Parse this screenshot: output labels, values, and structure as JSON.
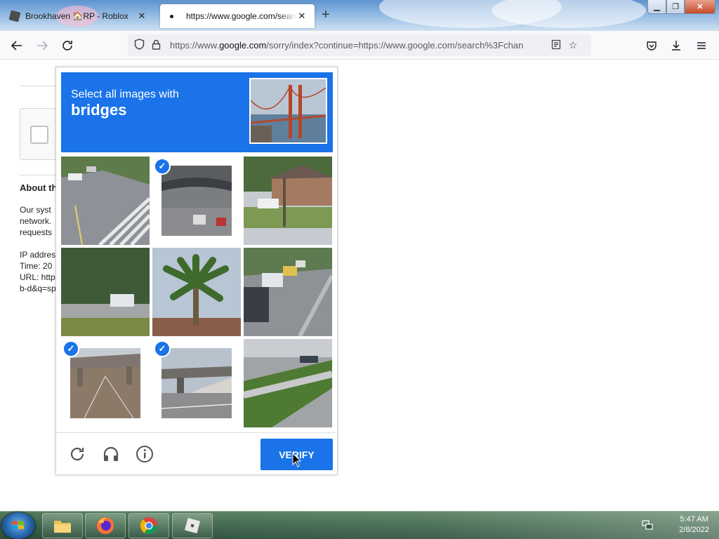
{
  "browser": {
    "tabs": [
      {
        "title": "Brookhaven 🏠RP - Roblox",
        "active": false
      },
      {
        "title": "https://www.google.com/search",
        "active": true
      }
    ],
    "url": {
      "prefix": "https://www.",
      "domain": "google.com",
      "rest": "/sorry/index?continue=https://www.google.com/search%3Fchan"
    }
  },
  "page_behind": {
    "heading": "About th",
    "para1": [
      "Our syst",
      "network.",
      "requests"
    ],
    "para2": [
      "IP addres",
      "Time: 20",
      "URL: http",
      "b-d&q=sp"
    ]
  },
  "captcha": {
    "instruction": "Select all images with",
    "target": "bridges",
    "tiles": [
      {
        "id": 1,
        "selected": false,
        "scene": "street-crosswalk"
      },
      {
        "id": 2,
        "selected": true,
        "scene": "overpass-traffic"
      },
      {
        "id": 3,
        "selected": false,
        "scene": "house-street"
      },
      {
        "id": 4,
        "selected": false,
        "scene": "trees-truck"
      },
      {
        "id": 5,
        "selected": false,
        "scene": "palm-tree"
      },
      {
        "id": 6,
        "selected": false,
        "scene": "parked-cars"
      },
      {
        "id": 7,
        "selected": true,
        "scene": "overpass-road"
      },
      {
        "id": 8,
        "selected": true,
        "scene": "overpass-highway"
      },
      {
        "id": 9,
        "selected": false,
        "scene": "sidewalk-grass"
      }
    ],
    "footer_icons": [
      "reload-icon",
      "headphones-icon",
      "info-icon"
    ],
    "verify_label": "VERIFY"
  },
  "taskbar": {
    "apps": [
      "file-explorer",
      "firefox",
      "chrome",
      "roblox"
    ],
    "time": "5:47 AM",
    "date": "2/8/2022"
  },
  "colors": {
    "accent": "#1a73e8",
    "taskbar": "#2f5a3c"
  }
}
